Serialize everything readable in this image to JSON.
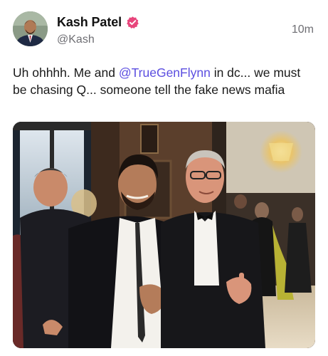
{
  "post": {
    "author": {
      "display_name": "Kash Patel",
      "handle": "@Kash",
      "verified": true,
      "verified_badge_color": "#e8467c"
    },
    "timestamp": "10m",
    "text": {
      "part1": "Uh ohhhh. Me and ",
      "mention": "@TrueGenFlynn",
      "part2": " in dc... we must be chasing Q... someone tell the fake news mafia"
    },
    "mention_color": "#5b4ee0",
    "media": {
      "type": "photo",
      "icon": "photo-attachment"
    }
  }
}
